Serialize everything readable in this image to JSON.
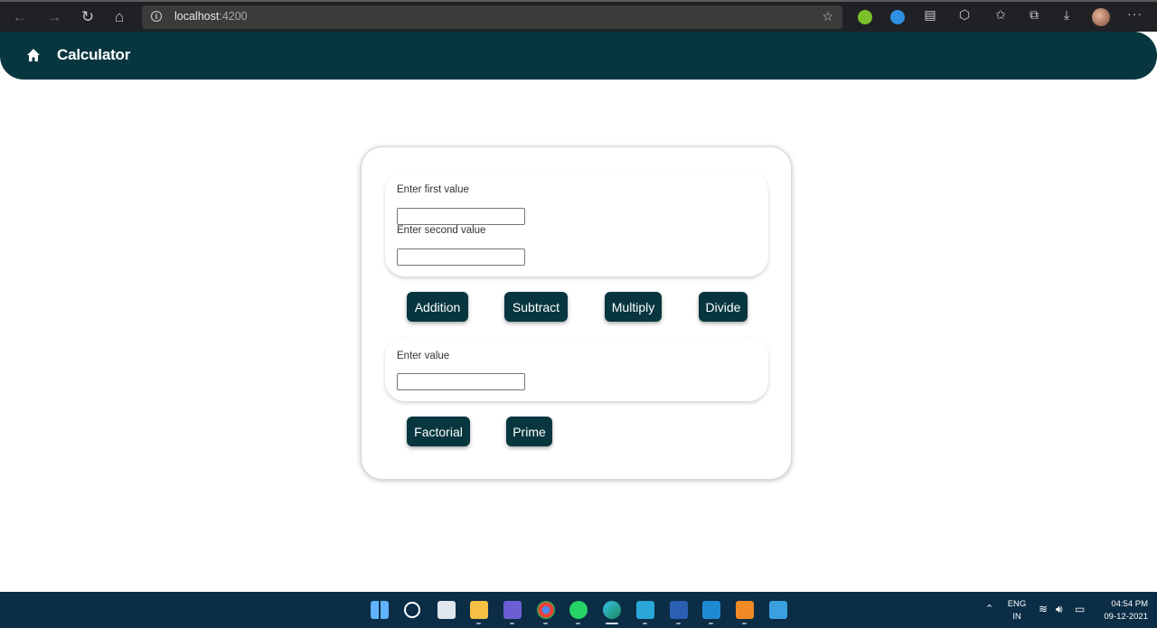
{
  "browser": {
    "url_host": "localhost",
    "url_port": ":4200",
    "icons": [
      "back-icon",
      "forward-icon",
      "refresh-icon",
      "home-icon",
      "info-icon",
      "favorite-add-icon",
      "collections-icon",
      "downloads-icon",
      "more-icon"
    ]
  },
  "app": {
    "title": "Calculator"
  },
  "binary_section": {
    "first_label": "Enter first value",
    "first_value": "",
    "second_label": "Enter second value",
    "second_value": ""
  },
  "binary_ops": {
    "addition": "Addition",
    "subtract": "Subtract",
    "multiply": "Multiply",
    "divide": "Divide"
  },
  "unary_section": {
    "label": "Enter value",
    "value": ""
  },
  "unary_ops": {
    "factorial": "Factorial",
    "prime": "Prime"
  },
  "taskbar": {
    "lang": "ENG",
    "region": "IN",
    "time": "04:54 PM",
    "date": "09-12-2021"
  },
  "colors": {
    "primary": "#07363f",
    "taskbar": "#0b2d46",
    "browser_chrome": "#202124"
  }
}
